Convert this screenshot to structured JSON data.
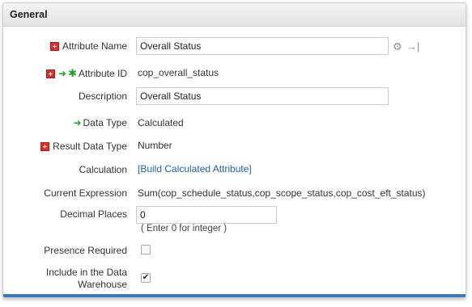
{
  "panel": {
    "title": "General"
  },
  "fields": {
    "attribute_name": {
      "label": "Attribute Name",
      "value": "Overall Status"
    },
    "attribute_id": {
      "label": "Attribute ID",
      "value": "cop_overall_status"
    },
    "description": {
      "label": "Description",
      "value": "Overall Status"
    },
    "data_type": {
      "label": "Data Type",
      "value": "Calculated"
    },
    "result_data_type": {
      "label": "Result Data Type",
      "value": "Number"
    },
    "calculation": {
      "label": "Calculation",
      "link": "[Build Calculated Attribute]"
    },
    "current_expression": {
      "label": "Current Expression",
      "value": "Sum(cop_schedule_status,cop_scope_status,cop_cost_eft_status)"
    },
    "decimal_places": {
      "label": "Decimal Places",
      "value": "0",
      "hint": "( Enter 0 for integer )"
    },
    "presence_required": {
      "label": "Presence Required",
      "checked": false
    },
    "include_warehouse": {
      "label": "Include in the Data Warehouse",
      "checked": true
    }
  },
  "icons": {
    "required": "required-icon",
    "arrow": "green-arrow-icon",
    "key": "key-star-icon",
    "translate": "translate-icon",
    "export": "export-arrow-icon"
  },
  "colors": {
    "required": "#d9302b",
    "indicator": "#2a9a2a",
    "link": "#2b5e9a",
    "bottom_bar": "#3b78b5"
  }
}
